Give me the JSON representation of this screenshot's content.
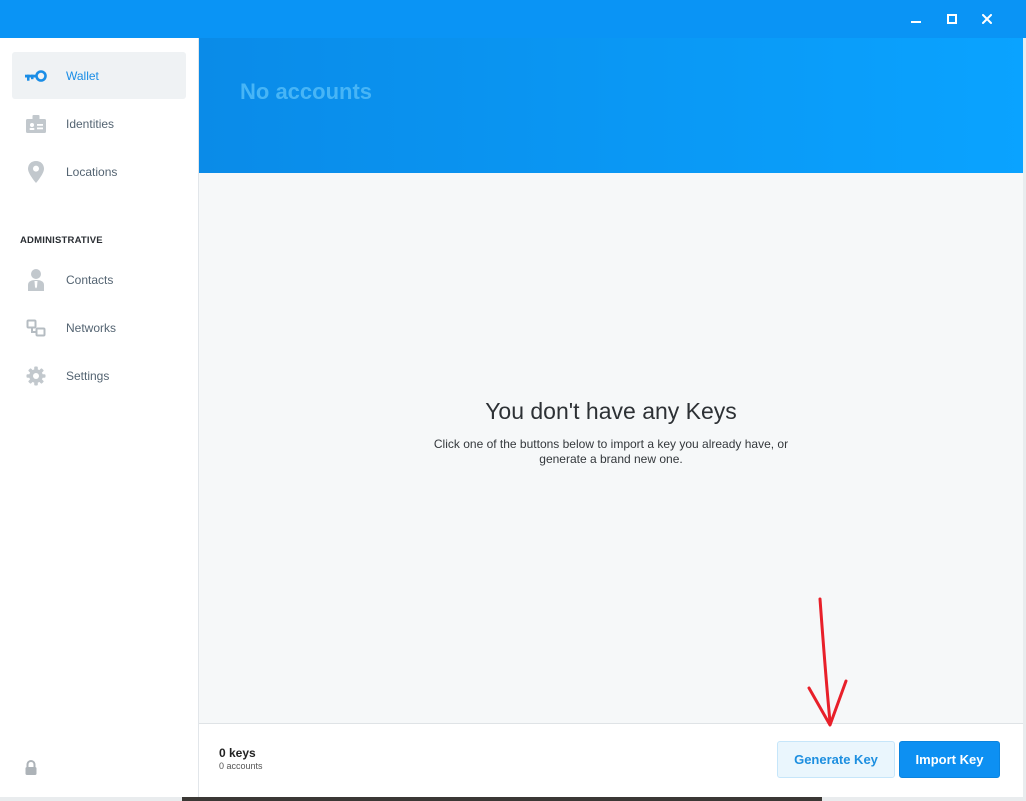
{
  "colors": {
    "accent": "#0a94f5",
    "banner_start": "#0a8be8",
    "banner_end": "#0aa3ff",
    "annotation_arrow": "#e8202a"
  },
  "window_controls": {
    "minimize_icon": "minimize-icon",
    "maximize_icon": "maximize-icon",
    "close_icon": "close-icon"
  },
  "sidebar": {
    "items": [
      {
        "label": "Wallet",
        "icon": "key-icon",
        "active": true
      },
      {
        "label": "Identities",
        "icon": "id-card-icon",
        "active": false
      },
      {
        "label": "Locations",
        "icon": "map-pin-icon",
        "active": false
      }
    ],
    "admin_section_label": "ADMINISTRATIVE",
    "admin_items": [
      {
        "label": "Contacts",
        "icon": "contact-person-icon"
      },
      {
        "label": "Networks",
        "icon": "network-icon"
      },
      {
        "label": "Settings",
        "icon": "gear-icon"
      }
    ],
    "lock_icon": "lock-icon"
  },
  "banner": {
    "title": "No accounts"
  },
  "empty_state": {
    "title": "You don't have any Keys",
    "description": "Click one of the buttons below to import a key you already have, or generate a brand new one."
  },
  "footer": {
    "keys_count": "0 keys",
    "accounts_count": "0 accounts",
    "generate_button": "Generate Key",
    "import_button": "Import Key"
  }
}
